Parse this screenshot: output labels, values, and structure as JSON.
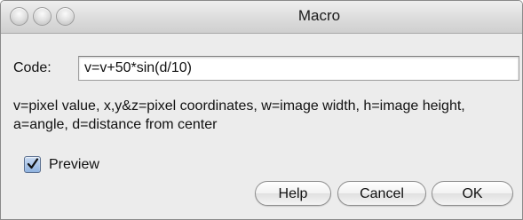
{
  "window": {
    "title": "Macro"
  },
  "form": {
    "code_label": "Code:",
    "code_value": "v=v+50*sin(d/10)",
    "help_text": "v=pixel value, x,y&z=pixel coordinates, w=image width, h=image height, a=angle, d=distance from center",
    "preview_label": "Preview",
    "preview_checked": true
  },
  "buttons": {
    "help": "Help",
    "cancel": "Cancel",
    "ok": "OK"
  }
}
